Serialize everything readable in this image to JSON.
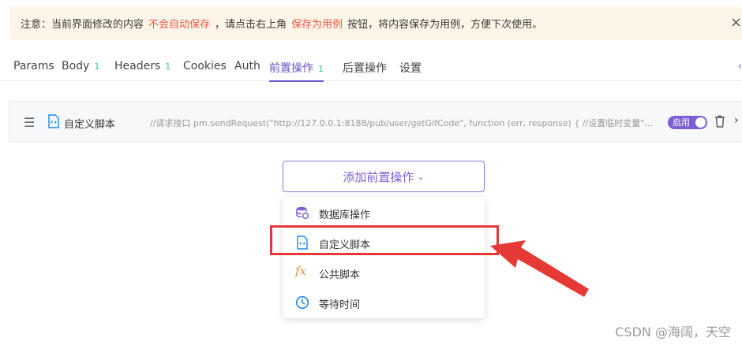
{
  "notice": {
    "prefix": "注意：当前界面修改的内容",
    "warn1": "不会自动保存",
    "mid": "，请点击右上角",
    "warn2": "保存为用例",
    "suffix": "按钮，将内容保存为用例，方便下次使用。",
    "close": "×"
  },
  "tabs": [
    {
      "label": "Params",
      "count": ""
    },
    {
      "label": "Body",
      "count": "1"
    },
    {
      "label": "Headers",
      "count": "1"
    },
    {
      "label": "Cookies",
      "count": ""
    },
    {
      "label": "Auth",
      "count": ""
    },
    {
      "label": "前置操作",
      "count": "1"
    },
    {
      "label": "后置操作",
      "count": ""
    },
    {
      "label": "设置",
      "count": ""
    }
  ],
  "script_row": {
    "title": "自定义脚本",
    "code": "//请求接口 pm.sendRequest(\"http://127.0.0.1:8188/pub/user/getGifCode\", function (err, response) { //设置临时变量\"GUI...",
    "toggle_label": "启用"
  },
  "add_button": {
    "label": "添加前置操作",
    "caret": "⌄"
  },
  "menu": {
    "items": [
      {
        "label": "数据库操作",
        "icon": "database-icon"
      },
      {
        "label": "自定义脚本",
        "icon": "script-file-icon"
      },
      {
        "label": "公共脚本",
        "icon": "fx-icon"
      },
      {
        "label": "等待时间",
        "icon": "clock-icon"
      }
    ]
  },
  "watermark": "CSDN @海阔，天空",
  "colors": {
    "accent": "#6a55c9",
    "warn": "#f5554a",
    "notice_bg": "#fdf6e8",
    "highlight": "#e53935"
  }
}
